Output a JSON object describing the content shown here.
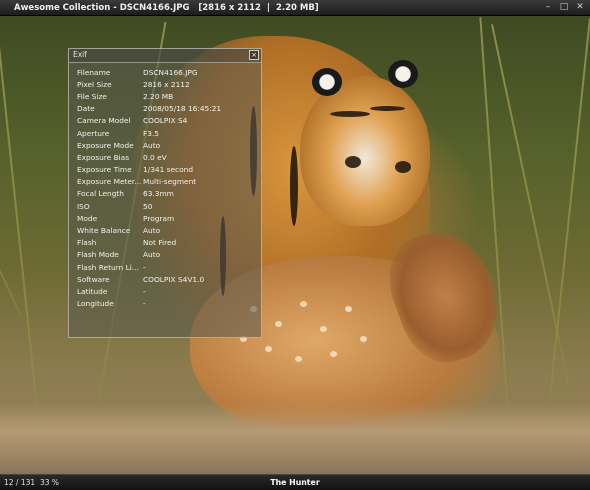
{
  "window": {
    "title": "Awesome Collection - DSCN4166.JPG",
    "dimensions": "[2816 x 2112",
    "separator": "|",
    "size": "2.20 MB]"
  },
  "exif": {
    "title": "Exif",
    "rows": [
      {
        "label": "Filename",
        "value": "DSCN4166.JPG"
      },
      {
        "label": "Pixel Size",
        "value": "2816 x 2112"
      },
      {
        "label": "File Size",
        "value": "2.20 MB"
      },
      {
        "label": "Date",
        "value": "2008/05/18 16:45:21"
      },
      {
        "label": "Camera Model",
        "value": "COOLPIX S4"
      },
      {
        "label": "Aperture",
        "value": "F3.5"
      },
      {
        "label": "Exposure Mode",
        "value": "Auto"
      },
      {
        "label": "Exposure Bias",
        "value": "0.0 eV"
      },
      {
        "label": "Exposure Time",
        "value": "1/341 second"
      },
      {
        "label": "Exposure Meter...",
        "value": "Multi-segment"
      },
      {
        "label": "Focal Length",
        "value": "63.3mm"
      },
      {
        "label": "ISO",
        "value": "50"
      },
      {
        "label": "Mode",
        "value": "Program"
      },
      {
        "label": "White Balance",
        "value": "Auto"
      },
      {
        "label": "Flash",
        "value": "Not Fired"
      },
      {
        "label": "Flash Mode",
        "value": "Auto"
      },
      {
        "label": "Flash Return Li...",
        "value": "-"
      },
      {
        "label": "Software",
        "value": "COOLPIX S4V1.0"
      },
      {
        "label": "Latitude",
        "value": "-"
      },
      {
        "label": "Longitude",
        "value": "-"
      }
    ]
  },
  "status": {
    "position": "12 / 131",
    "zoom": "33 %",
    "caption": "The Hunter"
  },
  "icons": {
    "close": "close-icon"
  }
}
